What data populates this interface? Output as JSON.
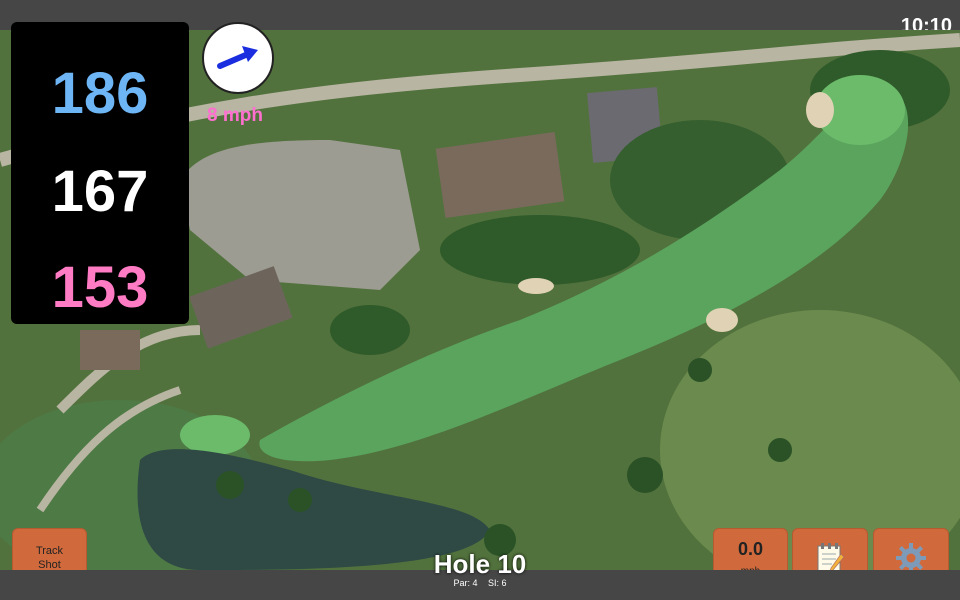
{
  "status": {
    "time": "10:10"
  },
  "distances": {
    "back": {
      "value": "186",
      "color": "#6db5f5"
    },
    "middle": {
      "value": "167",
      "color": "#ffffff"
    },
    "front": {
      "value": "153",
      "color": "#ff7bc4"
    }
  },
  "wind": {
    "speed_label": "8 mph",
    "direction_icon": "arrow-icon"
  },
  "buttons": {
    "track_shot": {
      "line1": "Track",
      "line2": "Shot"
    },
    "wind_speed": {
      "value": "0.0",
      "unit": "mph"
    },
    "notes_icon": "notepad-icon",
    "settings_icon": "gear-icon"
  },
  "hole": {
    "title": "Hole 10",
    "par": "Par: 4",
    "si": "SI: 6"
  },
  "colors": {
    "button_bg": "#d06a3c",
    "fairway": "#5aa45e",
    "water": "#2f4a45"
  }
}
